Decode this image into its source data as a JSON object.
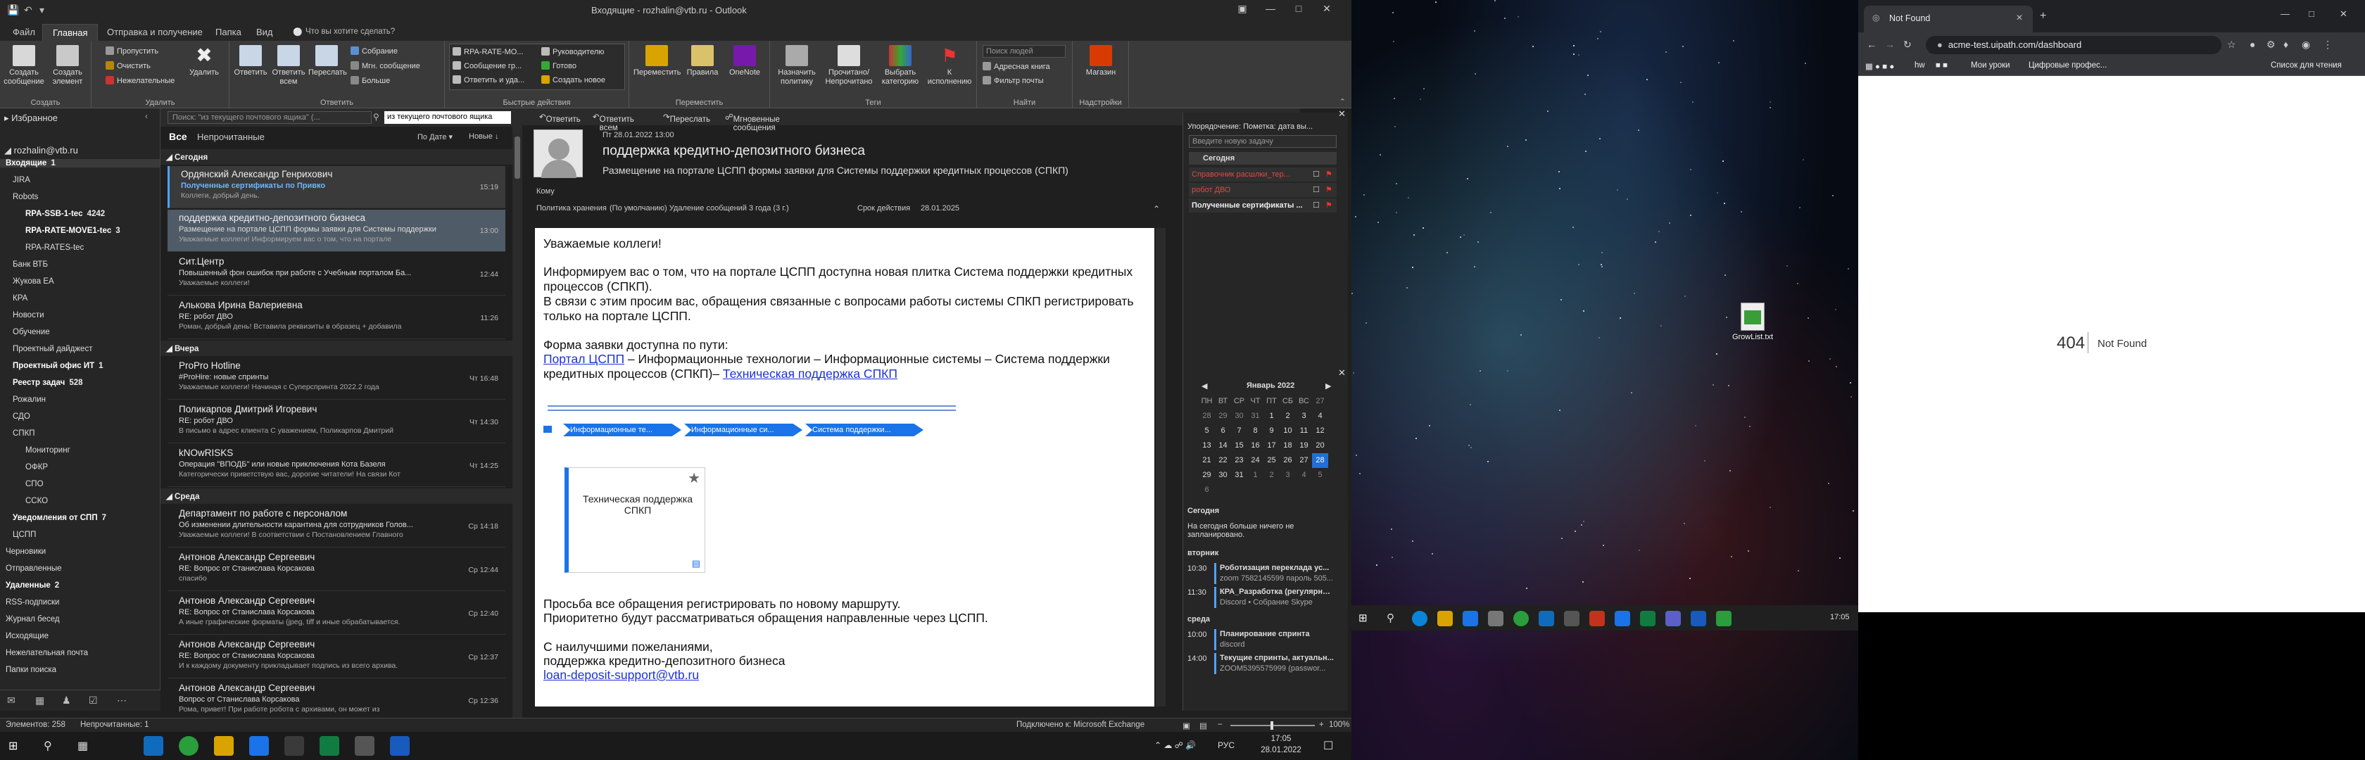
{
  "outlook": {
    "title": "Входящие - rozhalin@vtb.ru - Outlook",
    "tabs": [
      "Файл",
      "Главная",
      "Отправка и получение",
      "Папка",
      "Вид"
    ],
    "tell_me": "Что вы хотите сделать?",
    "ribbon": {
      "create": {
        "label": "Создать",
        "buttons": [
          "Создать сообщение",
          "Создать элемент"
        ]
      },
      "delete": {
        "label": "Удалить",
        "buttons": [
          "Пропустить",
          "Очистить",
          "Нежелательные",
          "Удалить"
        ]
      },
      "respond": {
        "label": "Ответить",
        "buttons": [
          "Ответить",
          "Ответить всем",
          "Переслать",
          "Собрание",
          "Мгн. сообщение",
          "Больше"
        ]
      },
      "quicksteps": {
        "label": "Быстрые действия",
        "items": [
          "RPA-RATE-MO...",
          "Сообщение гр...",
          "Ответить и уда...",
          "Руководителю",
          "Готово",
          "Создать новое"
        ]
      },
      "move": {
        "label": "Переместить",
        "buttons": [
          "Переместить",
          "Правила",
          "OneNote"
        ]
      },
      "tags": {
        "label": "Теги",
        "buttons": [
          "Назначить политику",
          "Прочитано/Непрочитано",
          "Выбрать категорию",
          "К исполнению"
        ]
      },
      "find": {
        "label": "Найти",
        "search_placeholder": "Поиск людей",
        "items": [
          "Адресная книга",
          "Фильтр почты"
        ]
      },
      "addins": {
        "label": "Надстройки",
        "buttons": [
          "Магазин"
        ]
      }
    },
    "nav": {
      "favorites": "Избранное",
      "account": "rozhalin@vtb.ru",
      "items": [
        {
          "label": "Входящие",
          "count": "1",
          "bold": true
        },
        {
          "label": "JIRA"
        },
        {
          "label": "Robots"
        },
        {
          "label": "RPA-SSB-1-tec",
          "count": "4242",
          "bold": true
        },
        {
          "label": "RPA-RATE-MOVE1-tec",
          "count": "3",
          "bold": true
        },
        {
          "label": "RPA-RATES-tec"
        },
        {
          "label": "Банк ВТБ"
        },
        {
          "label": "Жукова ЕА"
        },
        {
          "label": "КРА"
        },
        {
          "label": "Новости"
        },
        {
          "label": "Обучение"
        },
        {
          "label": "Проектный дайджест"
        },
        {
          "label": "Проектный офис ИТ",
          "count": "1",
          "bold": true
        },
        {
          "label": "Реестр задач",
          "count": "528",
          "bold": true
        },
        {
          "label": "Рожалин"
        },
        {
          "label": "СДО"
        },
        {
          "label": "СПКП"
        },
        {
          "label": "Мониторинг"
        },
        {
          "label": "ОФКР"
        },
        {
          "label": "СПО"
        },
        {
          "label": "ССКО"
        },
        {
          "label": "Уведомления от СПП",
          "count": "7",
          "bold": true
        },
        {
          "label": "ЦСПП"
        },
        {
          "label": "Черновики"
        },
        {
          "label": "Отправленные"
        },
        {
          "label": "Удаленные",
          "count": "2",
          "bold": true
        },
        {
          "label": "RSS-подписки"
        },
        {
          "label": "Журнал бесед"
        },
        {
          "label": "Исходящие"
        },
        {
          "label": "Нежелательная почта"
        },
        {
          "label": "Папки поиска"
        }
      ]
    },
    "list": {
      "search_placeholder": "Поиск: \"из текущего почтового ящика\" (...",
      "scope": "из текущего почтового ящика",
      "filters": [
        "Все",
        "Непрочитанные"
      ],
      "sort_by": "По Дате",
      "sort_order": "Новые",
      "groups": [
        {
          "label": "Сегодня",
          "messages": [
            {
              "from": "Ордянский Александр Генрихович",
              "subject": "Полученные сертификаты по Привко",
              "preview": "Коллеги, добрый день.",
              "time": "15:19",
              "unread": true,
              "selected": "first"
            },
            {
              "from": "поддержка кредитно-депозитного бизнеса",
              "subject": "Размещение на портале ЦСПП формы заявки для Системы поддержки",
              "preview": "Уважаемые коллеги! Информируем вас о том, что на портале",
              "time": "13:00",
              "selected": "active"
            },
            {
              "from": "Сит.Центр",
              "subject": "Повышенный фон ошибок при работе с Учебным порталом Ба...",
              "preview": "Уважаемые коллеги!",
              "time": "12:44"
            },
            {
              "from": "Алькова Ирина Валериевна",
              "subject": "RE: робот ДВО",
              "preview": "Роман, добрый день! Вставила реквизиты в образец + добавила",
              "time": "11:26"
            }
          ]
        },
        {
          "label": "Вчера",
          "messages": [
            {
              "from": "ProPro Hotline",
              "subject": "#ProHire: новые спринты",
              "preview": "Уважаемые коллеги! Начиная с Суперспринта 2022.2 года",
              "time": "Чт 16:48"
            },
            {
              "from": "Поликарпов Дмитрий Игоревич",
              "subject": "RE: робот ДВО",
              "preview": "В письмо в адрес клиента  С уважением,  Поликарпов Дмитрий",
              "time": "Чт 14:30"
            },
            {
              "from": "kNOwRISKS",
              "subject": "Операция \"ВПОДБ\" или новые приключения Кота Базеля",
              "preview": "Категорически приветствую вас, дорогие читатели!  На связи Кот",
              "time": "Чт 14:25"
            }
          ]
        },
        {
          "label": "Среда",
          "messages": [
            {
              "from": "Департамент по работе с персоналом",
              "subject": "Об изменении длительности карантина для сотрудников Голов...",
              "preview": "Уважаемые коллеги!  В соответствии с Постановлением Главного",
              "time": "Ср 14:18"
            },
            {
              "from": "Антонов Александр Сергеевич",
              "subject": "RE: Вопрос от Станислава Корсакова",
              "preview": "спасибо",
              "time": "Ср 12:44"
            },
            {
              "from": "Антонов Александр Сергеевич",
              "subject": "RE: Вопрос от Станислава Корсакова",
              "preview": "А иные графические форматы (jpeg, tiff и иные обрабатывается.",
              "time": "Ср 12:40"
            },
            {
              "from": "Антонов Александр Сергеевич",
              "subject": "RE: Вопрос от Станислава Корсакова",
              "preview": "И к каждому документу прикладывает подпись из всего архива.",
              "time": "Ср 12:37"
            },
            {
              "from": "Антонов Александр Сергеевич",
              "subject": "Вопрос от Станислава Корсакова",
              "preview": "Рома, привет!  При работе робота с архивами, он может из",
              "time": "Ср 12:36"
            }
          ]
        }
      ]
    },
    "reading": {
      "toolbar": [
        "Ответить",
        "Ответить всем",
        "Переслать",
        "Мгновенные сообщения"
      ],
      "date": "Пт 28.01.2022 13:00",
      "sender": "поддержка кредитно-депозитного бизнеса",
      "subject": "Размещение на портале ЦСПП формы заявки для Системы поддержки кредитных процессов (СПКП)",
      "to_label": "Кому",
      "policy_label": "Политика хранения",
      "policy_value": "(По умолчанию) Удаление сообщений 3 года (3 г.)",
      "expiry_label": "Срок действия",
      "expiry_value": "28.01.2025",
      "body": {
        "greeting": "Уважаемые коллеги!",
        "p1": "Информируем вас о том, что на портале ЦСПП доступна новая плитка Система поддержки кредитных процессов (СПКП).",
        "p2": "В связи с этим просим вас, обращения связанные с вопросами работы системы СПКП регистрировать только на портале ЦСПП.",
        "path_intro": "Форма заявки доступна по пути:",
        "link1": "Портал ЦСПП",
        "path_middle": " – Информационные технологии – Информационные системы – Система поддержки кредитных процессов (СПКП)– ",
        "link2": "Техническая поддержка СПКП",
        "breadcrumb": [
          "Информационные те...",
          "Информационные си...",
          "Система поддержки..."
        ],
        "tile": "Техническая поддержка СПКП",
        "p3": "Просьба все обращения регистрировать по новому маршруту.",
        "p4": "Приоритетно будут рассматриваться обращения направленные через ЦСПП.",
        "sign1": "С наилучшими пожеланиями,",
        "sign2": "поддержка кредитно-депозитного бизнеса",
        "email": "loan-deposit-support@vtb.ru"
      }
    },
    "todo": {
      "header": "Упорядочение: Пометка: дата вы...",
      "new_task_placeholder": "Введите новую задачу",
      "today_label": "Сегодня",
      "tasks": [
        "Справочник расшлки_тер...",
        "робот ДВО",
        "Полученные сертификаты ..."
      ],
      "calendar_title": "Январь 2022",
      "weekdays": [
        "ПН",
        "ВТ",
        "СР",
        "ЧТ",
        "ПТ",
        "СБ",
        "ВС"
      ],
      "weeks": [
        [
          "27",
          "28",
          "29",
          "30",
          "31",
          "1",
          "2"
        ],
        [
          "3",
          "4",
          "5",
          "6",
          "7",
          "8",
          "9"
        ],
        [
          "10",
          "11",
          "12",
          "13",
          "14",
          "15",
          "16"
        ],
        [
          "17",
          "18",
          "19",
          "20",
          "21",
          "22",
          "23"
        ],
        [
          "24",
          "25",
          "26",
          "27",
          "28",
          "29",
          "30"
        ],
        [
          "31",
          "1",
          "2",
          "3",
          "4",
          "5",
          "6"
        ]
      ],
      "today_day": "28",
      "agenda_today": "Сегодня",
      "agenda_empty": "На сегодня больше ничего не запланировано.",
      "agenda": [
        {
          "day": "вторник",
          "items": [
            {
              "time": "10:30",
              "title": "Роботизация переклада ус...",
              "sub": "zoom 7582145599 пароль 505..."
            },
            {
              "time": "11:30",
              "title": "КРА_Разработка (регулярны...",
              "sub": "Discord • Собрание Skype"
            }
          ]
        },
        {
          "day": "среда",
          "items": [
            {
              "time": "10:00",
              "title": "Планирование спринта",
              "sub": "discord"
            },
            {
              "time": "14:00",
              "title": "Текущие спринты, актуальн...",
              "sub": "ZOOM5395575999 (passwor..."
            }
          ]
        }
      ]
    },
    "status": {
      "items": "Элементов: 258",
      "unread": "Непрочитанные: 1",
      "connection": "Подключено к: Microsoft Exchange",
      "zoom": "100%"
    }
  },
  "taskbar": {
    "lang": "РУС",
    "time": "17:05",
    "date": "28.01.2022"
  },
  "desktop": {
    "icon_label": "GrowList.txt"
  },
  "taskbar2": {
    "time": "17:05"
  },
  "chrome": {
    "tab_title": "Not Found",
    "url": "acme-test.uipath.com/dashboard",
    "bookmarks": [
      "hw",
      "Мои уроки",
      "Цифровые профес..."
    ],
    "reading_list": "Список для чтения",
    "error_code": "404",
    "error_text": "Not Found"
  }
}
